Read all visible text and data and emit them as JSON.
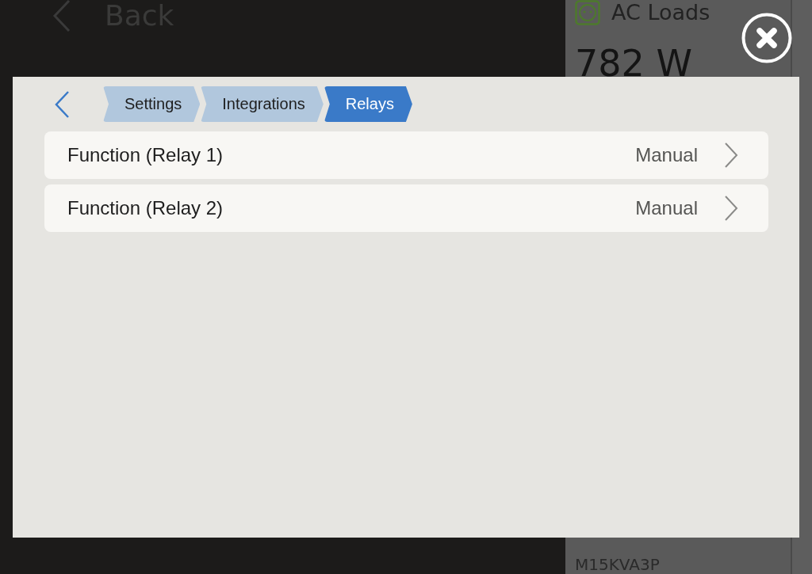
{
  "background": {
    "header": {
      "back_label": "Back"
    },
    "side_panel": {
      "title": "AC Loads",
      "power": "782 W",
      "footer": "M15KVA3P"
    }
  },
  "dialog": {
    "breadcrumbs": [
      {
        "label": "Settings",
        "selected": false
      },
      {
        "label": "Integrations",
        "selected": false
      },
      {
        "label": "Relays",
        "selected": true
      }
    ],
    "items": [
      {
        "label": "Function (Relay 1)",
        "value": "Manual"
      },
      {
        "label": "Function (Relay 2)",
        "value": "Manual"
      }
    ]
  }
}
